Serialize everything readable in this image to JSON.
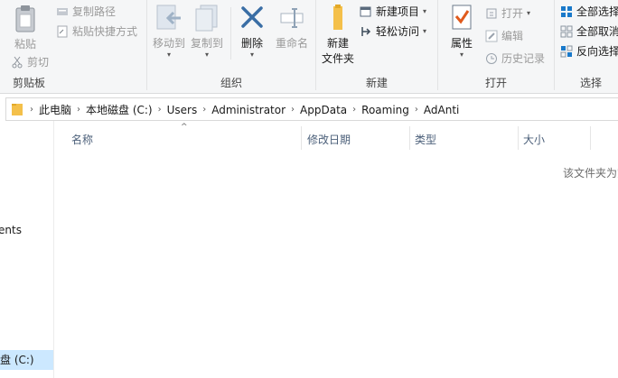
{
  "ribbon": {
    "clipboard": {
      "label": "剪贴板",
      "paste": "粘贴",
      "copy_path": "复制路径",
      "paste_shortcut": "粘贴快捷方式",
      "cut": "剪切"
    },
    "organize": {
      "label": "组织",
      "move_to": "移动到",
      "copy_to": "复制到",
      "delete": "删除",
      "rename": "重命名"
    },
    "new": {
      "label": "新建",
      "new_folder_line1": "新建",
      "new_folder_line2": "文件夹",
      "new_item": "新建项目",
      "easy_access": "轻松访问"
    },
    "open": {
      "label": "打开",
      "properties": "属性",
      "open": "打开",
      "edit": "编辑",
      "history": "历史记录"
    },
    "select": {
      "label": "选择",
      "select_all": "全部选择",
      "select_none": "全部取消",
      "invert": "反向选择"
    }
  },
  "address": {
    "crumbs": [
      "此电脑",
      "本地磁盘 (C:)",
      "Users",
      "Administrator",
      "AppData",
      "Roaming",
      "AdAnti"
    ]
  },
  "nav": {
    "items": [
      "ents",
      "盘 (C:)"
    ]
  },
  "columns": {
    "name": "名称",
    "modified": "修改日期",
    "type": "类型",
    "size": "大小"
  },
  "empty_text": "该文件夹为空。",
  "colors": {
    "accent": "#1979ca",
    "selected": "#cce8ff",
    "folder": "#f4c04a",
    "delete": "#3a6ea5"
  }
}
